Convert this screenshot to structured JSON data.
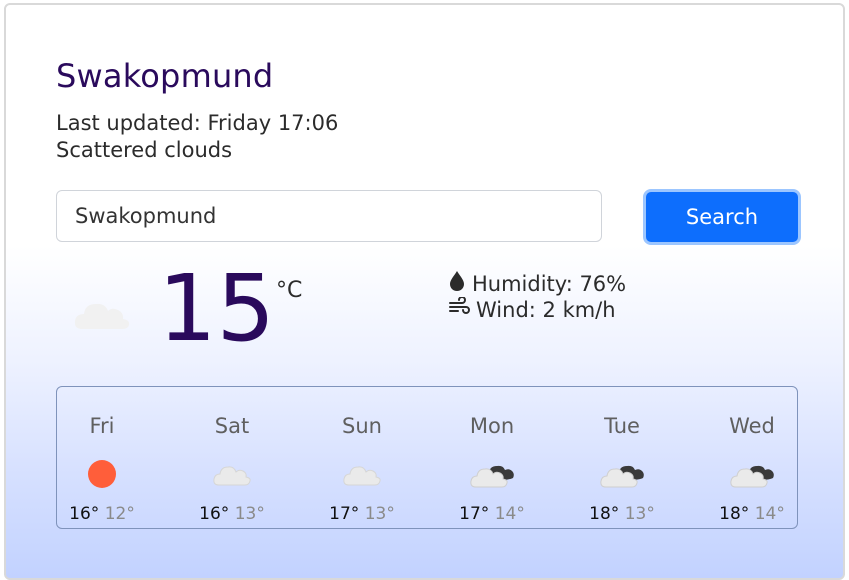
{
  "location": {
    "city": "Swakopmund",
    "last_updated": "Last updated: Friday 17:06",
    "description": "Scattered clouds"
  },
  "search": {
    "value": "Swakopmund",
    "button_label": "Search"
  },
  "current": {
    "icon": "cloud-icon",
    "temperature": "15",
    "unit": "°C",
    "humidity": "Humidity: 76%",
    "wind": "Wind: 2 km/h"
  },
  "forecast": [
    {
      "day": "Fri",
      "icon": "sun-icon",
      "high": "16°",
      "low": "12°"
    },
    {
      "day": "Sat",
      "icon": "cloud-icon",
      "high": "16°",
      "low": "13°"
    },
    {
      "day": "Sun",
      "icon": "cloud-icon",
      "high": "17°",
      "low": "13°"
    },
    {
      "day": "Mon",
      "icon": "broken-clouds-icon",
      "high": "17°",
      "low": "14°"
    },
    {
      "day": "Tue",
      "icon": "broken-clouds-icon",
      "high": "18°",
      "low": "13°"
    },
    {
      "day": "Wed",
      "icon": "broken-clouds-icon",
      "high": "18°",
      "low": "14°"
    }
  ],
  "colors": {
    "title": "#2a0a5c",
    "button": "#0d6efd",
    "sun": "#ff5e3a"
  }
}
